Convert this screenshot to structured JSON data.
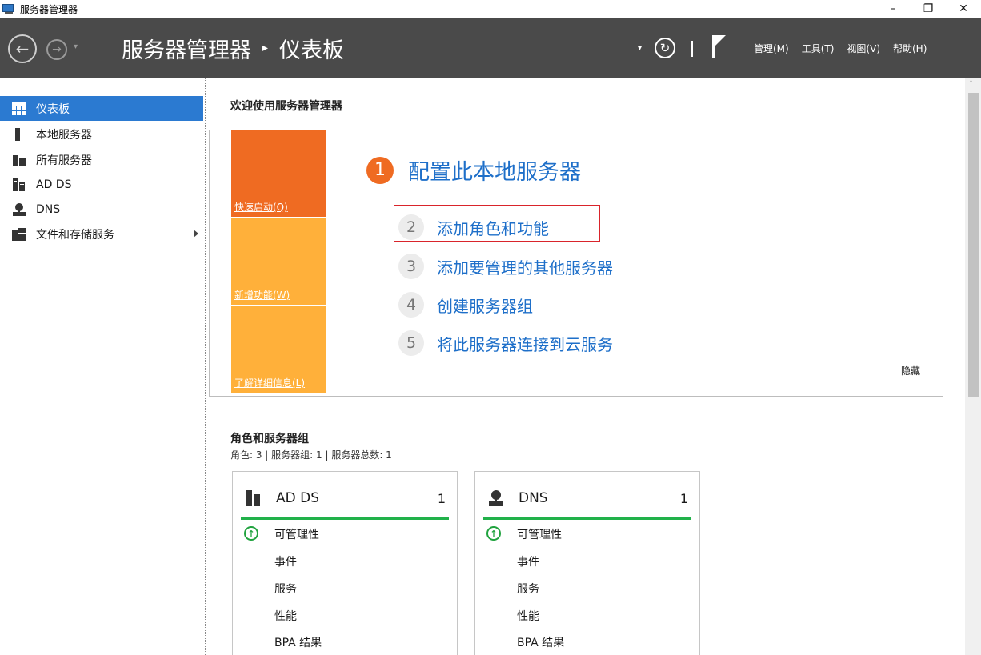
{
  "window": {
    "title": "服务器管理器",
    "minimize": "–",
    "restore": "❐",
    "close": "✕"
  },
  "header": {
    "back_glyph": "←",
    "forward_glyph": "→",
    "dropdown_glyph": "▾",
    "breadcrumb_root": "服务器管理器",
    "breadcrumb_sep": "▸",
    "breadcrumb_current": "仪表板",
    "refresh_glyph": "↻",
    "menus": [
      "管理(M)",
      "工具(T)",
      "视图(V)",
      "帮助(H)"
    ]
  },
  "sidebar": {
    "items": [
      {
        "label": "仪表板",
        "icon": "dashboard-icon",
        "active": true
      },
      {
        "label": "本地服务器",
        "icon": "server-icon"
      },
      {
        "label": "所有服务器",
        "icon": "servers-icon"
      },
      {
        "label": "AD DS",
        "icon": "ad-ds-icon"
      },
      {
        "label": "DNS",
        "icon": "dns-icon"
      },
      {
        "label": "文件和存储服务",
        "icon": "file-storage-icon",
        "expandable": true
      }
    ]
  },
  "welcome": {
    "title": "欢迎使用服务器管理器",
    "tiles": [
      "快速启动(Q)",
      "新增功能(W)",
      "了解详细信息(L)"
    ],
    "steps": [
      {
        "num": "1",
        "label": "配置此本地服务器"
      },
      {
        "num": "2",
        "label": "添加角色和功能"
      },
      {
        "num": "3",
        "label": "添加要管理的其他服务器"
      },
      {
        "num": "4",
        "label": "创建服务器组"
      },
      {
        "num": "5",
        "label": "将此服务器连接到云服务"
      }
    ],
    "hide": "隐藏"
  },
  "roles": {
    "title": "角色和服务器组",
    "subtitle": "角色: 3 | 服务器组: 1 | 服务器总数: 1",
    "cards": [
      {
        "name": "AD DS",
        "count": "1",
        "icon": "ad-ds-icon",
        "rows": [
          "可管理性",
          "事件",
          "服务",
          "性能",
          "BPA 结果"
        ]
      },
      {
        "name": "DNS",
        "count": "1",
        "icon": "dns-icon",
        "rows": [
          "可管理性",
          "事件",
          "服务",
          "性能",
          "BPA 结果"
        ]
      }
    ],
    "status_color": "#21b14a"
  },
  "colors": {
    "header_bg": "#4a4a4a",
    "accent": "#2b7ad1",
    "link": "#1e6fc9",
    "tile_orange": "#ef6b22",
    "tile_yellow": "#ffb03a",
    "highlight": "#d9242b"
  },
  "scrollbar": {
    "up_glyph": "˄"
  }
}
